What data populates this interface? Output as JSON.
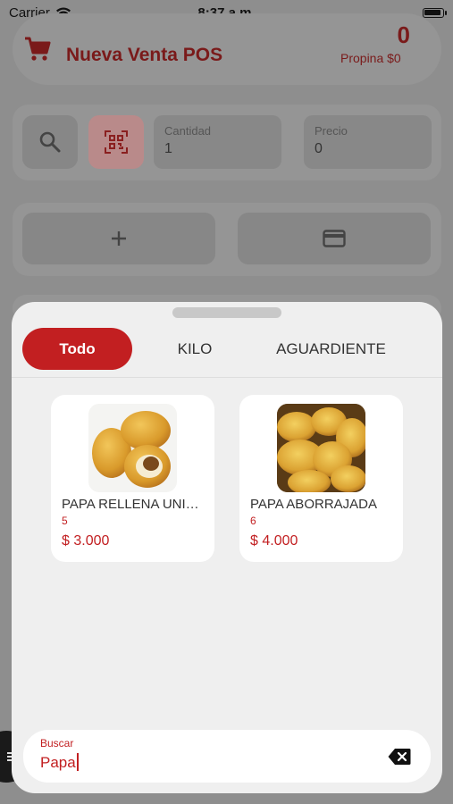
{
  "status_bar": {
    "carrier": "Carrier",
    "time": "8:37 a.m."
  },
  "header": {
    "title": "Nueva Venta POS",
    "counter": "0",
    "propina": "Propina $0"
  },
  "inputs": {
    "cantidad_label": "Cantidad",
    "cantidad_value": "1",
    "precio_label": "Precio",
    "precio_value": "0"
  },
  "tabs": [
    {
      "label": "Todo",
      "active": true
    },
    {
      "label": "KILO",
      "active": false
    },
    {
      "label": "AGUARDIENTE",
      "active": false
    }
  ],
  "products": [
    {
      "name": "PAPA RELLENA UNID…",
      "code": "5",
      "price": "$ 3.000"
    },
    {
      "name": "PAPA ABORRAJADA",
      "code": "6",
      "price": "$ 4.000"
    }
  ],
  "search": {
    "label": "Buscar",
    "value": "Papa"
  },
  "colors": {
    "accent": "#c21f21",
    "sheet_bg": "#efefef",
    "overlay_bg": "#8e8e8e"
  }
}
